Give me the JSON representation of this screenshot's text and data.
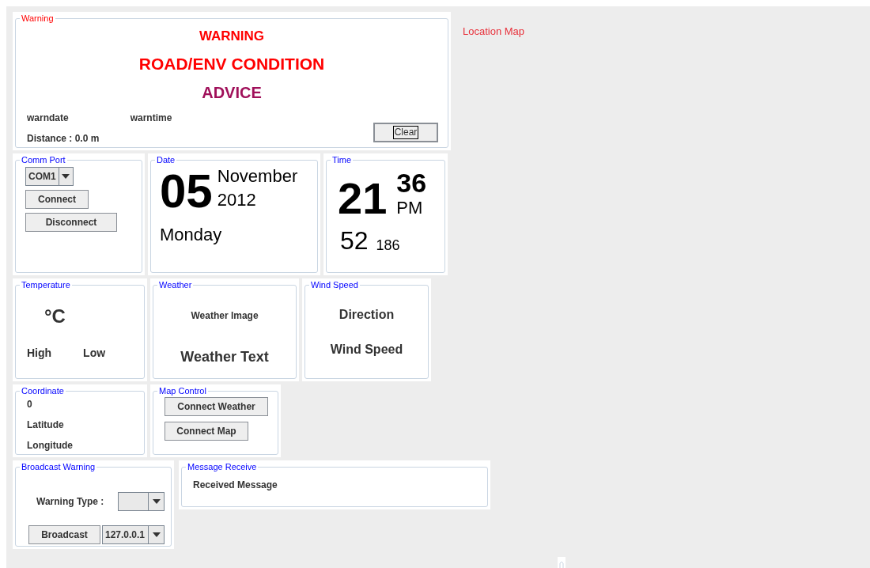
{
  "warning": {
    "legend": "Warning",
    "title": "WARNING",
    "condition": "ROAD/ENV CONDITION",
    "advice": "ADVICE",
    "date": "warndate",
    "time": "warntime",
    "distance": "Distance : 0.0 m",
    "clear_button": "Clear"
  },
  "comm_port": {
    "legend": "Comm Port",
    "port": "COM1",
    "buttons": [
      "Connect",
      "Disconnect"
    ]
  },
  "date": {
    "legend": "Date",
    "day": "05",
    "month": "November",
    "year": "2012",
    "weekday": "Monday"
  },
  "time": {
    "legend": "Time",
    "hour": "21",
    "minute": "36",
    "ampm": "PM",
    "second": "52",
    "millisecond": "186"
  },
  "temperature": {
    "legend": "Temperature",
    "unit": "°C",
    "high": "High",
    "low": "Low"
  },
  "weather": {
    "legend": "Weather",
    "image": "Weather Image",
    "text": "Weather Text"
  },
  "wind": {
    "legend": "Wind Speed",
    "direction": "Direction",
    "speed": "Wind Speed"
  },
  "coordinate": {
    "legend": "Coordinate",
    "value": "0",
    "latitude": "Latitude",
    "longitude": "Longitude"
  },
  "map_control": {
    "legend": "Map Control",
    "buttons": [
      "Connect Weather",
      "Connect Map"
    ]
  },
  "broadcast": {
    "legend": "Broadcast Warning",
    "warning_type_label": "Warning Type :",
    "broadcast_button": "Broadcast",
    "address": "127.0.0.1"
  },
  "message": {
    "legend": "Message Receive",
    "text": "Received Message"
  },
  "map": {
    "title": "Location Map"
  }
}
